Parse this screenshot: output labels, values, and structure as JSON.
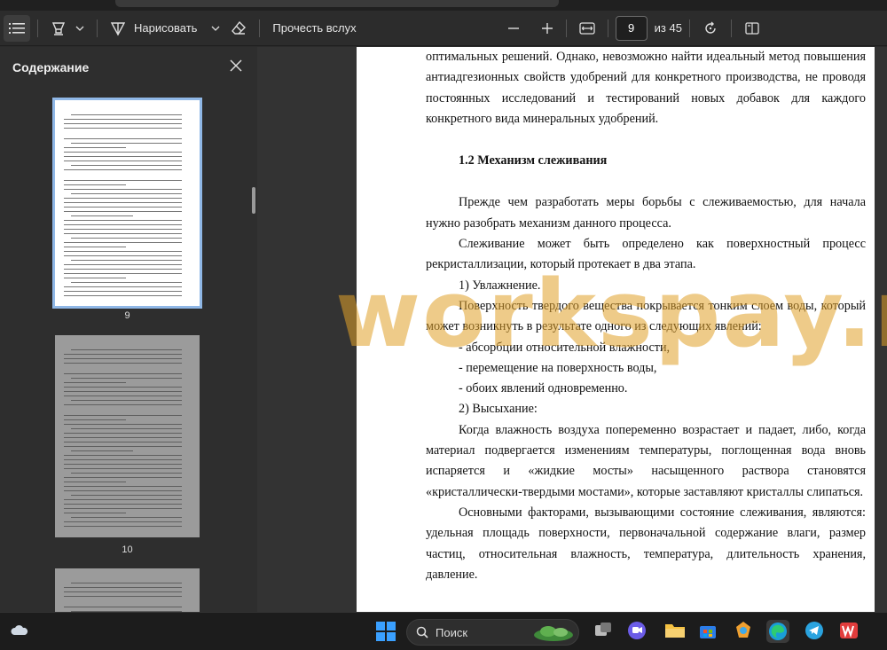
{
  "toolbar": {
    "draw_label": "Нарисовать",
    "read_aloud_label": "Прочесть вслух",
    "page_current": "9",
    "page_total": "из 45"
  },
  "sidebar": {
    "title": "Содержание",
    "thumbnails": [
      {
        "page": "9"
      },
      {
        "page": "10"
      }
    ]
  },
  "document": {
    "paragraphs": [
      {
        "style": "cont",
        "text": "оптимальных решений. Однако, невозможно найти идеальный метод повышения антиадгезионных свойств удобрений для конкретного производства, не проводя постоянных исследований и тестирований новых добавок для каждого конкретного вида минеральных удобрений."
      },
      {
        "style": "heading",
        "text": "1.2 Механизм слеживания"
      },
      {
        "style": "indent",
        "text": "Прежде чем разработать меры борьбы с слеживаемостью, для начала нужно разобрать механизм данного процесса."
      },
      {
        "style": "indent",
        "text": "Слеживание может быть определено как поверхностный процесс рекристаллизации, который протекает в два этапа."
      },
      {
        "style": "li",
        "text": "1) Увлажнение."
      },
      {
        "style": "indent",
        "text": "Поверхность твердого вещества покрывается тонким слоем воды, который может возникнуть в результате одного из следующих явлений:"
      },
      {
        "style": "li",
        "text": "- абсорбции относительной влажности,"
      },
      {
        "style": "li",
        "text": "- перемещение на поверхность воды,"
      },
      {
        "style": "li",
        "text": "- обоих явлений одновременно."
      },
      {
        "style": "li",
        "text": "2) Высыхание:"
      },
      {
        "style": "indent",
        "text": "Когда влажность воздуха попеременно возрастает и падает, либо, когда материал подвергается изменениям температуры, поглощенная вода вновь испаряется и «жидкие мосты» насыщенного раствора становятся «кристаллически-твердыми мостами», которые заставляют кристаллы слипаться."
      },
      {
        "style": "indent",
        "text": "Основными факторами, вызывающими состояние слеживания, являются: удельная площадь поверхности, первоначальной содержание влаги, размер частиц, относительная влажность, температура, длительность хранения, давление."
      }
    ],
    "watermark": "workspay.ru"
  },
  "taskbar": {
    "search_label": "Поиск"
  },
  "colors": {
    "watermark": "#e0a028",
    "selection": "#8fb7e6"
  }
}
